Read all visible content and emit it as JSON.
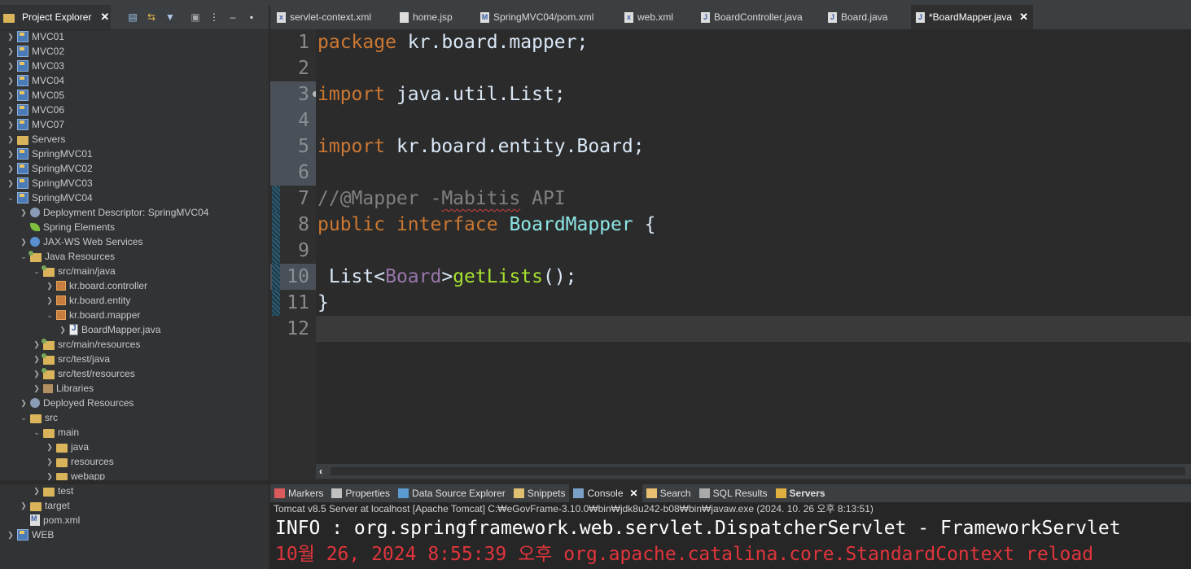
{
  "explorer": {
    "title": "Project Explorer",
    "items": [
      {
        "label": "MVC01",
        "icon": "project-icon"
      },
      {
        "label": "MVC02",
        "icon": "project-icon"
      },
      {
        "label": "MVC03",
        "icon": "project-icon"
      },
      {
        "label": "MVC04",
        "icon": "project-icon"
      },
      {
        "label": "MVC05",
        "icon": "project-icon"
      },
      {
        "label": "MVC06",
        "icon": "project-icon"
      },
      {
        "label": "MVC07",
        "icon": "project-icon"
      },
      {
        "label": "Servers",
        "icon": "folder-icon"
      },
      {
        "label": "SpringMVC01",
        "icon": "project-icon"
      },
      {
        "label": "SpringMVC02",
        "icon": "project-icon"
      },
      {
        "label": "SpringMVC03",
        "icon": "project-icon"
      },
      {
        "label": "SpringMVC04",
        "icon": "project-icon"
      },
      {
        "label": "Deployment Descriptor: SpringMVC04",
        "icon": "deployment-descriptor-icon"
      },
      {
        "label": "Spring Elements",
        "icon": "spring-leaf-icon"
      },
      {
        "label": "JAX-WS Web Services",
        "icon": "web-services-icon"
      },
      {
        "label": "Java Resources",
        "icon": "java-resources-icon"
      },
      {
        "label": "src/main/java",
        "icon": "source-folder-icon"
      },
      {
        "label": "kr.board.controller",
        "icon": "package-icon"
      },
      {
        "label": "kr.board.entity",
        "icon": "package-icon"
      },
      {
        "label": "kr.board.mapper",
        "icon": "package-icon"
      },
      {
        "label": "BoardMapper.java",
        "icon": "java-interface-icon"
      },
      {
        "label": "src/main/resources",
        "icon": "source-folder-icon"
      },
      {
        "label": "src/test/java",
        "icon": "source-folder-icon"
      },
      {
        "label": "src/test/resources",
        "icon": "source-folder-icon"
      },
      {
        "label": "Libraries",
        "icon": "libraries-icon"
      },
      {
        "label": "Deployed Resources",
        "icon": "deployed-resources-icon"
      },
      {
        "label": "src",
        "icon": "folder-icon"
      },
      {
        "label": "main",
        "icon": "folder-icon"
      },
      {
        "label": "java",
        "icon": "folder-icon"
      },
      {
        "label": "resources",
        "icon": "folder-icon"
      },
      {
        "label": "webapp",
        "icon": "folder-icon"
      },
      {
        "label": "test",
        "icon": "folder-icon"
      },
      {
        "label": "target",
        "icon": "folder-icon"
      },
      {
        "label": "pom.xml",
        "icon": "maven-pom-icon"
      },
      {
        "label": "WEB",
        "icon": "project-icon"
      }
    ]
  },
  "editor": {
    "tabs": [
      {
        "label": "servlet-context.xml"
      },
      {
        "label": "home.jsp"
      },
      {
        "label": "SpringMVC04/pom.xml"
      },
      {
        "label": "web.xml"
      },
      {
        "label": "BoardController.java"
      },
      {
        "label": "Board.java"
      },
      {
        "label": "*BoardMapper.java"
      }
    ],
    "line_numbers": [
      "1",
      "2",
      "3",
      "4",
      "5",
      "6",
      "7",
      "8",
      "9",
      "10",
      "11",
      "12"
    ],
    "code": {
      "l1_kw": "package",
      "l1_rest": " kr.board.mapper;",
      "l3_kw": "import",
      "l3_rest": " java.util.List;",
      "l5_kw": "import",
      "l5_rest": " kr.board.entity.Board;",
      "l7_a": "//@Mapper -",
      "l7_b": "Mabitis",
      "l7_c": " API",
      "l8_kw1": "public",
      "l8_kw2": "interface",
      "l8_name": "BoardMapper",
      "l8_brace": " {",
      "l10_a": " List<",
      "l10_b": "Board",
      "l10_c": ">",
      "l10_d": "getLists",
      "l10_e": "();",
      "l11": "}"
    }
  },
  "console": {
    "tabs": [
      {
        "label": "Markers"
      },
      {
        "label": "Properties"
      },
      {
        "label": "Data Source Explorer"
      },
      {
        "label": "Snippets"
      },
      {
        "label": "Console"
      },
      {
        "label": "Search"
      },
      {
        "label": "SQL Results"
      },
      {
        "label": "Servers"
      }
    ],
    "description": "Tomcat v8.5 Server at localhost [Apache Tomcat] C:₩eGovFrame-3.10.0₩bin₩jdk8u242-b08₩bin₩javaw.exe  (2024. 10. 26 오후 8:13:51)",
    "line1": "INFO : org.springframework.web.servlet.DispatcherServlet - FrameworkServlet",
    "line2": "10월 26, 2024 8:55:39 오후 org.apache.catalina.core.StandardContext reload"
  },
  "colors": {
    "keyword": "#cc7832",
    "comment": "#808080",
    "type_param": "#9876aa",
    "interface_name": "#8ee6e6",
    "method": "#a6e22e",
    "console_error": "#e0353c"
  }
}
